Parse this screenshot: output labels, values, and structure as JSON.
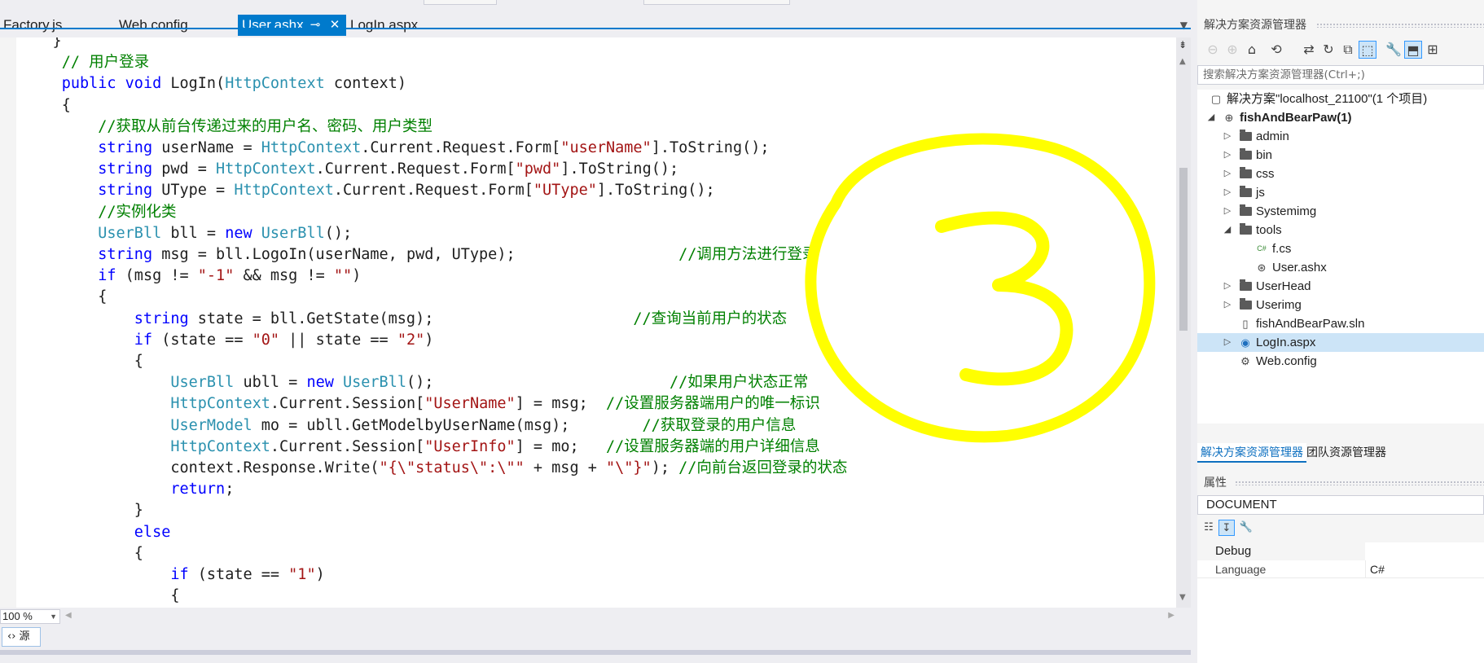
{
  "editor": {
    "tabs": [
      {
        "label": "Factory.js"
      },
      {
        "label": "Web.config"
      },
      {
        "label": "User.ashx",
        "active": true
      },
      {
        "label": "LogIn.aspx"
      }
    ],
    "pin_glyph": "⊸",
    "close_glyph": "✕",
    "code_lines": [
      [
        {
          "t": "    }"
        }
      ],
      [
        {
          "t": "     // 用户登录",
          "c": "cm"
        }
      ],
      [
        {
          "t": "     "
        },
        {
          "t": "public",
          "c": "kw"
        },
        {
          "t": " "
        },
        {
          "t": "void",
          "c": "kw"
        },
        {
          "t": " LogIn("
        },
        {
          "t": "HttpContext",
          "c": "ty"
        },
        {
          "t": " context)"
        }
      ],
      [
        {
          "t": "     {"
        }
      ],
      [
        {
          "t": "         "
        },
        {
          "t": "//获取从前台传递过来的用户名、密码、用户类型",
          "c": "cm"
        }
      ],
      [
        {
          "t": "         "
        },
        {
          "t": "string",
          "c": "kw"
        },
        {
          "t": " userName = "
        },
        {
          "t": "HttpContext",
          "c": "ty"
        },
        {
          "t": ".Current.Request.Form["
        },
        {
          "t": "\"userName\"",
          "c": "st"
        },
        {
          "t": "].ToString();"
        }
      ],
      [
        {
          "t": "         "
        },
        {
          "t": "string",
          "c": "kw"
        },
        {
          "t": " pwd = "
        },
        {
          "t": "HttpContext",
          "c": "ty"
        },
        {
          "t": ".Current.Request.Form["
        },
        {
          "t": "\"pwd\"",
          "c": "st"
        },
        {
          "t": "].ToString();"
        }
      ],
      [
        {
          "t": "         "
        },
        {
          "t": "string",
          "c": "kw"
        },
        {
          "t": " UType = "
        },
        {
          "t": "HttpContext",
          "c": "ty"
        },
        {
          "t": ".Current.Request.Form["
        },
        {
          "t": "\"UType\"",
          "c": "st"
        },
        {
          "t": "].ToString();"
        }
      ],
      [
        {
          "t": "         "
        },
        {
          "t": "//实例化类",
          "c": "cm"
        }
      ],
      [
        {
          "t": "         "
        },
        {
          "t": "UserBll",
          "c": "ty"
        },
        {
          "t": " bll = "
        },
        {
          "t": "new",
          "c": "kw"
        },
        {
          "t": " "
        },
        {
          "t": "UserBll",
          "c": "ty"
        },
        {
          "t": "();"
        }
      ],
      [
        {
          "t": "         "
        },
        {
          "t": "string",
          "c": "kw"
        },
        {
          "t": " msg = bll.LogoIn(userName, pwd, UType);                  "
        },
        {
          "t": "//调用方法进行登录",
          "c": "cm"
        }
      ],
      [
        {
          "t": "         "
        },
        {
          "t": "if",
          "c": "kw"
        },
        {
          "t": " (msg != "
        },
        {
          "t": "\"-1\"",
          "c": "st"
        },
        {
          "t": " && msg != "
        },
        {
          "t": "\"\"",
          "c": "st"
        },
        {
          "t": ")"
        }
      ],
      [
        {
          "t": "         {"
        }
      ],
      [
        {
          "t": "             "
        },
        {
          "t": "string",
          "c": "kw"
        },
        {
          "t": " state = bll.GetState(msg);                      "
        },
        {
          "t": "//查询当前用户的状态",
          "c": "cm"
        }
      ],
      [
        {
          "t": "             "
        },
        {
          "t": "if",
          "c": "kw"
        },
        {
          "t": " (state == "
        },
        {
          "t": "\"0\"",
          "c": "st"
        },
        {
          "t": " || state == "
        },
        {
          "t": "\"2\"",
          "c": "st"
        },
        {
          "t": ")"
        }
      ],
      [
        {
          "t": "             {"
        }
      ],
      [
        {
          "t": "                 "
        },
        {
          "t": "UserBll",
          "c": "ty"
        },
        {
          "t": " ubll = "
        },
        {
          "t": "new",
          "c": "kw"
        },
        {
          "t": " "
        },
        {
          "t": "UserBll",
          "c": "ty"
        },
        {
          "t": "();                          "
        },
        {
          "t": "//如果用户状态正常",
          "c": "cm"
        }
      ],
      [
        {
          "t": "                 "
        },
        {
          "t": "HttpContext",
          "c": "ty"
        },
        {
          "t": ".Current.Session["
        },
        {
          "t": "\"UserName\"",
          "c": "st"
        },
        {
          "t": "] = msg;  "
        },
        {
          "t": "//设置服务器端用户的唯一标识",
          "c": "cm"
        }
      ],
      [
        {
          "t": "                 "
        },
        {
          "t": "UserModel",
          "c": "ty"
        },
        {
          "t": " mo = ubll.GetModelbyUserName(msg);        "
        },
        {
          "t": "//获取登录的用户信息",
          "c": "cm"
        }
      ],
      [
        {
          "t": "                 "
        },
        {
          "t": "HttpContext",
          "c": "ty"
        },
        {
          "t": ".Current.Session["
        },
        {
          "t": "\"UserInfo\"",
          "c": "st"
        },
        {
          "t": "] = mo;   "
        },
        {
          "t": "//设置服务器端的用户详细信息",
          "c": "cm"
        }
      ],
      [
        {
          "t": "                 context.Response.Write("
        },
        {
          "t": "\"{\\\"status\\\":\\\"\"",
          "c": "st"
        },
        {
          "t": " + msg + "
        },
        {
          "t": "\"\\\"}\"",
          "c": "st"
        },
        {
          "t": "); "
        },
        {
          "t": "//向前台返回登录的状态",
          "c": "cm"
        }
      ],
      [
        {
          "t": "                 "
        },
        {
          "t": "return",
          "c": "kw"
        },
        {
          "t": ";"
        }
      ],
      [
        {
          "t": "             }"
        }
      ],
      [
        {
          "t": "             "
        },
        {
          "t": "else",
          "c": "kw"
        }
      ],
      [
        {
          "t": "             {"
        }
      ],
      [
        {
          "t": "                 "
        },
        {
          "t": "if",
          "c": "kw"
        },
        {
          "t": " (state == "
        },
        {
          "t": "\"1\"",
          "c": "st"
        },
        {
          "t": ")"
        }
      ],
      [
        {
          "t": "                 {"
        }
      ]
    ],
    "zoom": "100 %",
    "source_button": "‹› 源",
    "annotation_color": "#ffff00"
  },
  "solution_explorer": {
    "title": "解决方案资源管理器",
    "search_placeholder": "搜索解决方案资源管理器(Ctrl+;)",
    "toolbar_icons": [
      "back-icon",
      "forward-icon",
      "home-icon",
      "sync-icon",
      "pending-changes-icon",
      "refresh-icon",
      "collapse-icon",
      "show-all-icon",
      "properties-icon",
      "preview-icon",
      "view-class-icon"
    ],
    "tree": [
      {
        "label": "解决方案\"localhost_21100\"(1 个项目)",
        "level": 0,
        "expander": "",
        "icon": "solution-icon",
        "glyph": "▢"
      },
      {
        "label": "fishAndBearPaw(1)",
        "level": 0,
        "expander": "◢",
        "icon": "website-icon",
        "glyph": "⊕",
        "bold": true
      },
      {
        "label": "admin",
        "level": 1,
        "expander": "▷",
        "icon": "folder-icon",
        "folder": true
      },
      {
        "label": "bin",
        "level": 1,
        "expander": "▷",
        "icon": "folder-icon",
        "folder": true
      },
      {
        "label": "css",
        "level": 1,
        "expander": "▷",
        "icon": "folder-icon",
        "folder": true
      },
      {
        "label": "js",
        "level": 1,
        "expander": "▷",
        "icon": "folder-icon",
        "folder": true
      },
      {
        "label": "Systemimg",
        "level": 1,
        "expander": "▷",
        "icon": "folder-icon",
        "folder": true
      },
      {
        "label": "tools",
        "level": 1,
        "expander": "◢",
        "icon": "folder-open-icon",
        "folder": true
      },
      {
        "label": "f.cs",
        "level": 2,
        "expander": "",
        "icon": "csharp-file-icon",
        "glyph": "C#"
      },
      {
        "label": "User.ashx",
        "level": 2,
        "expander": "",
        "icon": "handler-file-icon",
        "glyph": "⊛"
      },
      {
        "label": "UserHead",
        "level": 1,
        "expander": "▷",
        "icon": "folder-icon",
        "folder": true
      },
      {
        "label": "Userimg",
        "level": 1,
        "expander": "▷",
        "icon": "folder-icon",
        "folder": true
      },
      {
        "label": "fishAndBearPaw.sln",
        "level": 1,
        "expander": "",
        "icon": "file-icon",
        "glyph": "▯"
      },
      {
        "label": "LogIn.aspx",
        "level": 1,
        "expander": "▷",
        "icon": "aspx-file-icon",
        "glyph": "◉",
        "selected": true
      },
      {
        "label": "Web.config",
        "level": 1,
        "expander": "",
        "icon": "config-file-icon",
        "glyph": "⚙"
      }
    ],
    "bottom_tabs": [
      {
        "label": "解决方案资源管理器",
        "active": true
      },
      {
        "label": "团队资源管理器"
      }
    ]
  },
  "properties": {
    "title": "属性",
    "object": "DOCUMENT",
    "category": "Debug",
    "rows": [
      {
        "key": "Language",
        "value": "C#"
      }
    ]
  }
}
